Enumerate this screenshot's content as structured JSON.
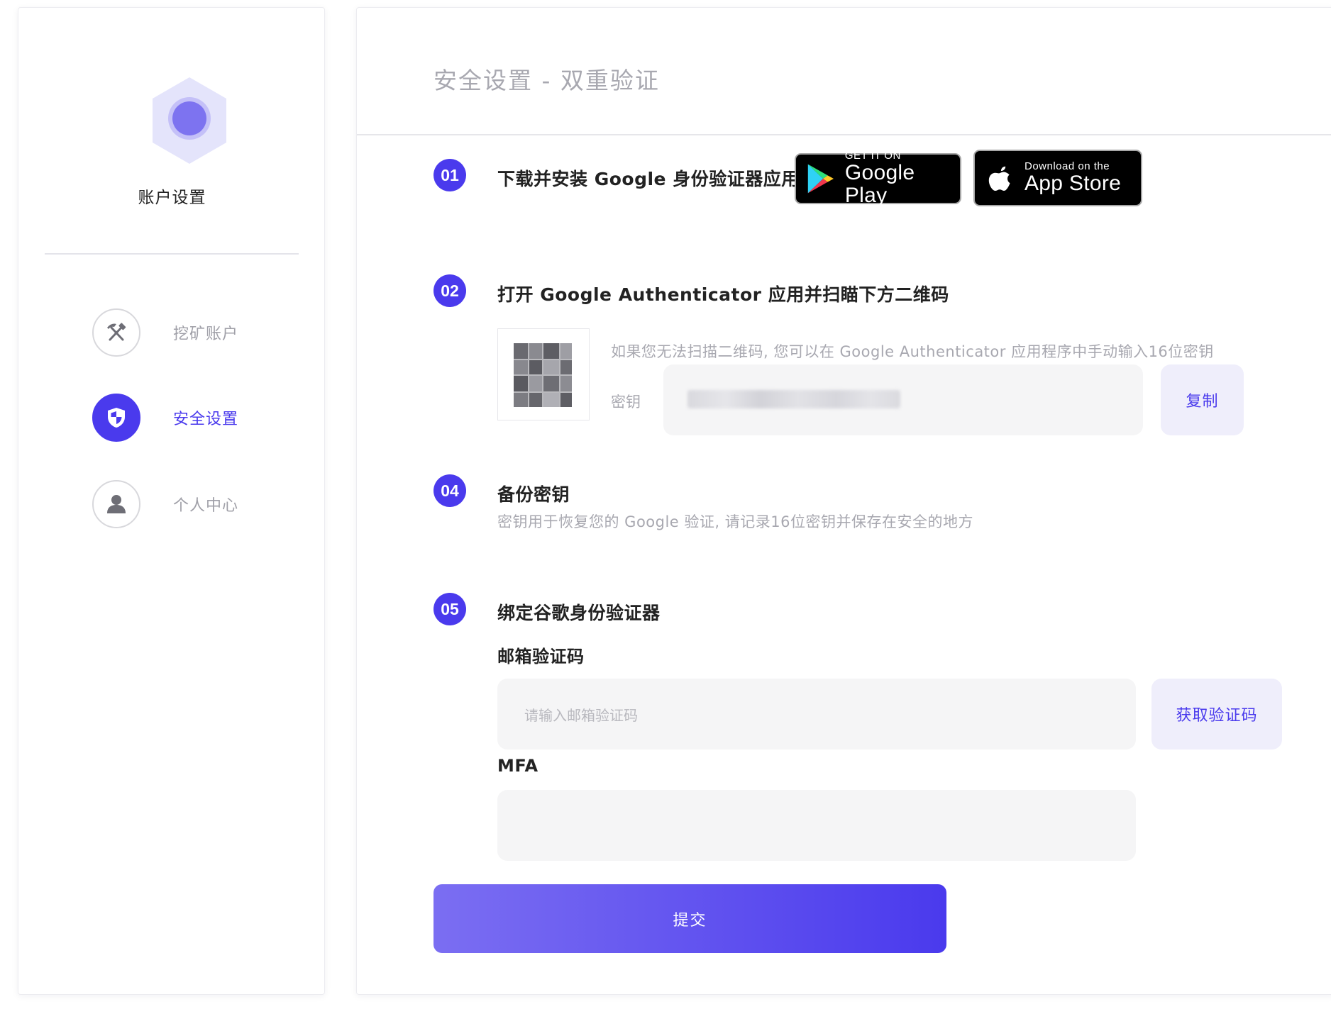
{
  "sidebar": {
    "title": "账户设置",
    "items": [
      {
        "label": "挖矿账户",
        "icon": "pickaxe-hammer-icon",
        "active": false
      },
      {
        "label": "安全设置",
        "icon": "shield-icon",
        "active": true
      },
      {
        "label": "个人中心",
        "icon": "user-icon",
        "active": false
      }
    ]
  },
  "main": {
    "title": "安全设置 - 双重验证",
    "steps": [
      {
        "num": "01",
        "title": "下载并安装 Google 身份验证器应用",
        "badges": {
          "google_play": {
            "small": "GET IT ON",
            "big": "Google Play"
          },
          "app_store": {
            "small": "Download on the",
            "big": "App Store"
          }
        }
      },
      {
        "num": "02",
        "title": "打开 Google Authenticator 应用并扫瞄下方二维码",
        "hint": "如果您无法扫描二维码, 您可以在 Google Authenticator 应用程序中手动输入16位密钥",
        "secret_label": "密钥",
        "copy_label": "复制"
      },
      {
        "num": "04",
        "title": "备份密钥",
        "desc": "密钥用于恢复您的 Google 验证, 请记录16位密钥并保存在安全的地方"
      },
      {
        "num": "05",
        "title": "绑定谷歌身份验证器",
        "email_label": "邮箱验证码",
        "email_placeholder": "请输入邮箱验证码",
        "get_code_label": "获取验证码",
        "mfa_label": "MFA",
        "mfa_value": ""
      }
    ],
    "submit_label": "提交"
  },
  "colors": {
    "accent": "#4a3aed",
    "accent_light": "#efeefb",
    "input_bg": "#f5f5f6",
    "muted_text": "#a8a8b0"
  }
}
